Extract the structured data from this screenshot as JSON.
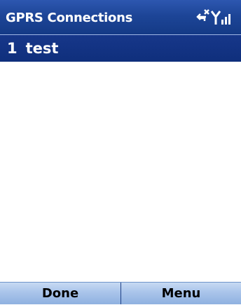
{
  "header": {
    "title": "GPRS Connections",
    "status_icons": [
      "disconnected-icon",
      "signal-strength-icon"
    ]
  },
  "connections": [
    {
      "number": "1",
      "name": "test",
      "selected": true
    }
  ],
  "softkeys": {
    "left_label": "Done",
    "right_label": "Menu"
  },
  "colors": {
    "title_bar": "#1d4597",
    "selection": "#0f2f7c",
    "softkey_bar": "#a9c4ea"
  }
}
